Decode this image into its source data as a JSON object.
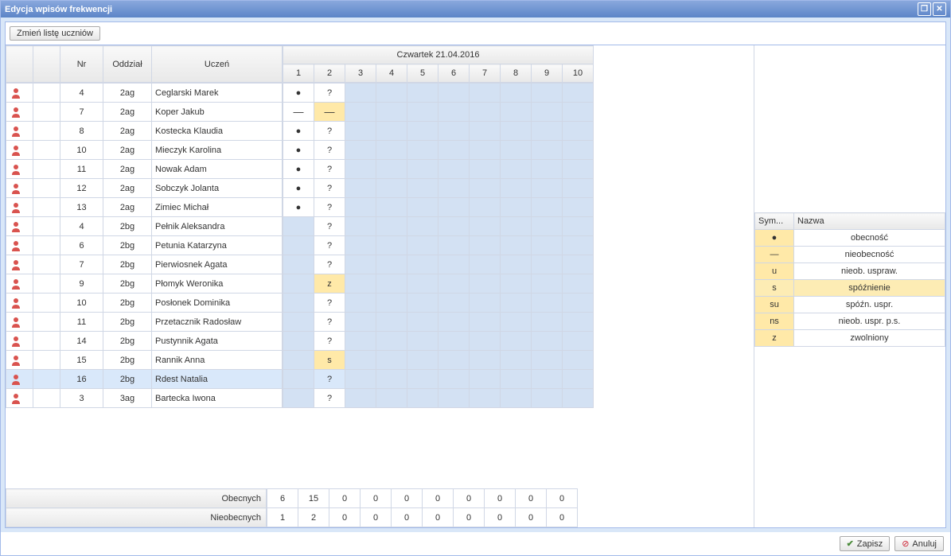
{
  "window": {
    "title": "Edycja wpisów frekwencji",
    "change_list_button": "Zmień listę uczniów",
    "save_button": "Zapisz",
    "cancel_button": "Anuluj"
  },
  "headers": {
    "nr": "Nr",
    "class": "Oddział",
    "student": "Uczeń",
    "date": "Czwartek 21.04.2016",
    "lessons": [
      "1",
      "2",
      "3",
      "4",
      "5",
      "6",
      "7",
      "8",
      "9",
      "10"
    ],
    "present_label": "Obecnych",
    "absent_label": "Nieobecnych"
  },
  "students": [
    {
      "nr": "4",
      "class": "2ag",
      "name": "Ceglarski Marek",
      "l1": "●",
      "l2": "?"
    },
    {
      "nr": "7",
      "class": "2ag",
      "name": "Koper Jakub",
      "l1": "—",
      "l2": "—",
      "yellow2": true
    },
    {
      "nr": "8",
      "class": "2ag",
      "name": "Kostecka Klaudia",
      "l1": "●",
      "l2": "?"
    },
    {
      "nr": "10",
      "class": "2ag",
      "name": "Mieczyk Karolina",
      "l1": "●",
      "l2": "?"
    },
    {
      "nr": "11",
      "class": "2ag",
      "name": "Nowak Adam",
      "l1": "●",
      "l2": "?"
    },
    {
      "nr": "12",
      "class": "2ag",
      "name": "Sobczyk Jolanta",
      "l1": "●",
      "l2": "?"
    },
    {
      "nr": "13",
      "class": "2ag",
      "name": "Zimiec Michał",
      "l1": "●",
      "l2": "?"
    },
    {
      "nr": "4",
      "class": "2bg",
      "name": "Pełnik Aleksandra",
      "l1": "",
      "l2": "?",
      "disabled1": true
    },
    {
      "nr": "6",
      "class": "2bg",
      "name": "Petunia Katarzyna",
      "l1": "",
      "l2": "?",
      "disabled1": true
    },
    {
      "nr": "7",
      "class": "2bg",
      "name": "Pierwiosnek Agata",
      "l1": "",
      "l2": "?",
      "disabled1": true
    },
    {
      "nr": "9",
      "class": "2bg",
      "name": "Płomyk Weronika",
      "l1": "",
      "l2": "z",
      "disabled1": true,
      "yellow2": true
    },
    {
      "nr": "10",
      "class": "2bg",
      "name": "Posłonek Dominika",
      "l1": "",
      "l2": "?",
      "disabled1": true
    },
    {
      "nr": "11",
      "class": "2bg",
      "name": "Przetacznik Radosław",
      "l1": "",
      "l2": "?",
      "disabled1": true
    },
    {
      "nr": "14",
      "class": "2bg",
      "name": "Pustynnik Agata",
      "l1": "",
      "l2": "?",
      "disabled1": true
    },
    {
      "nr": "15",
      "class": "2bg",
      "name": "Rannik Anna",
      "l1": "",
      "l2": "s",
      "disabled1": true,
      "yellow2": true
    },
    {
      "nr": "16",
      "class": "2bg",
      "name": "Rdest Natalia",
      "l1": "",
      "l2": "?",
      "disabled1": true,
      "highlighted": true
    },
    {
      "nr": "3",
      "class": "3ag",
      "name": "Bartecka Iwona",
      "l1": "",
      "l2": "?",
      "disabled1": true
    }
  ],
  "totals": {
    "present": [
      "6",
      "15",
      "0",
      "0",
      "0",
      "0",
      "0",
      "0",
      "0",
      "0"
    ],
    "absent": [
      "1",
      "2",
      "0",
      "0",
      "0",
      "0",
      "0",
      "0",
      "0",
      "0"
    ]
  },
  "legend": {
    "sym_header": "Sym...",
    "name_header": "Nazwa",
    "items": [
      {
        "sym": "●",
        "name": "obecność"
      },
      {
        "sym": "—",
        "name": "nieobecność"
      },
      {
        "sym": "u",
        "name": "nieob. usprаw."
      },
      {
        "sym": "s",
        "name": "spóźnienie",
        "highlighted": true
      },
      {
        "sym": "su",
        "name": "spóźn. uspr."
      },
      {
        "sym": "ns",
        "name": "nieob. uspr. p.s."
      },
      {
        "sym": "z",
        "name": "zwolniony"
      }
    ]
  }
}
